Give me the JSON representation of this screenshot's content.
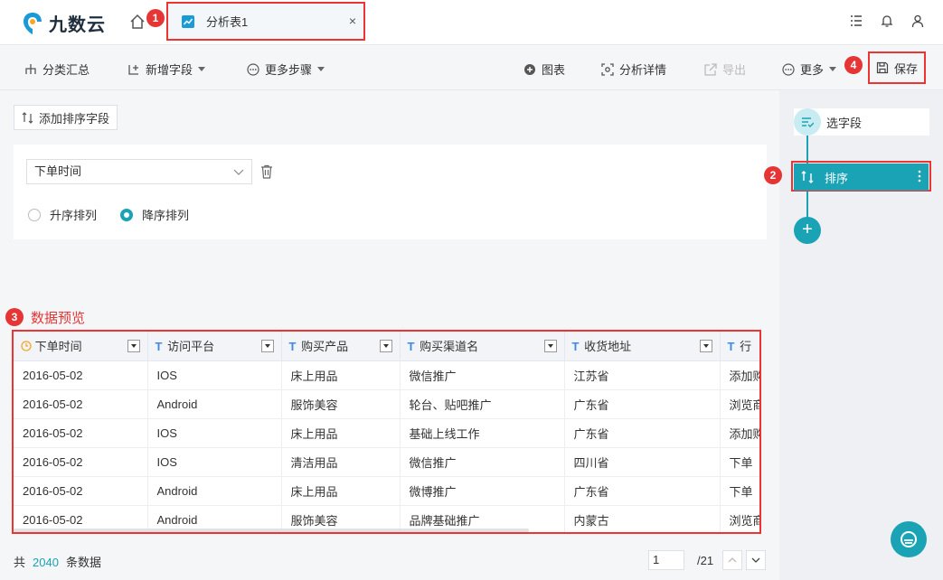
{
  "header": {
    "logo_text": "九数云",
    "tab_label": "分析表1",
    "tab_close": "×"
  },
  "markers": {
    "m1": "1",
    "m2": "2",
    "m3": "3",
    "m4": "4"
  },
  "toolbar": {
    "group_summary": "分类汇总",
    "add_field": "新增字段",
    "more_steps": "更多步骤",
    "chart": "图表",
    "analysis_detail": "分析详情",
    "export": "导出",
    "more": "更多",
    "save": "保存"
  },
  "sort": {
    "add_button": "添加排序字段",
    "field_value": "下单时间",
    "asc_label": "升序排列",
    "desc_label": "降序排列",
    "selected": "desc"
  },
  "preview": {
    "title": "数据预览",
    "columns": [
      "下单时间",
      "访问平台",
      "购买产品",
      "购买渠道名",
      "收货地址",
      "行"
    ],
    "rows": [
      [
        "2016-05-02",
        "IOS",
        "床上用品",
        "微信推广",
        "江苏省",
        "添加购"
      ],
      [
        "2016-05-02",
        "Android",
        "服饰美容",
        "轮台、贴吧推广",
        "广东省",
        "浏览商"
      ],
      [
        "2016-05-02",
        "IOS",
        "床上用品",
        "基础上线工作",
        "广东省",
        "添加购"
      ],
      [
        "2016-05-02",
        "IOS",
        "清洁用品",
        "微信推广",
        "四川省",
        "下单"
      ],
      [
        "2016-05-02",
        "Android",
        "床上用品",
        "微博推广",
        "广东省",
        "下单"
      ],
      [
        "2016-05-02",
        "Android",
        "服饰美容",
        "品牌基础推广",
        "内蒙古",
        "浏览商"
      ]
    ]
  },
  "footer": {
    "count_prefix": "共",
    "count": "2040",
    "count_suffix": "条数据",
    "page_value": "1",
    "page_total": "/21"
  },
  "steps": {
    "select_fields": "选字段",
    "sort": "排序",
    "add": "+"
  },
  "colors": {
    "accent": "#19a3b5",
    "marker": "#e63535"
  }
}
